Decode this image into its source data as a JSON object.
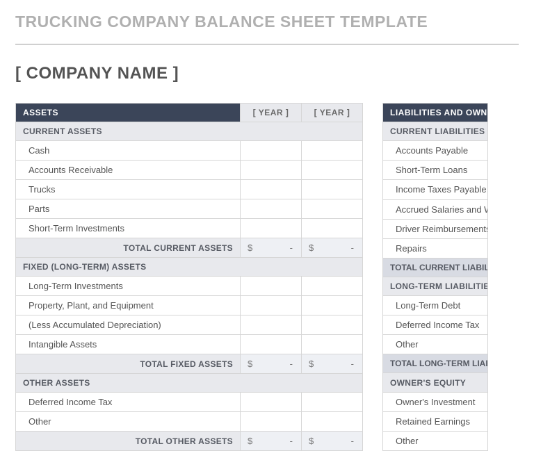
{
  "title": "TRUCKING COMPANY BALANCE SHEET TEMPLATE",
  "company": "[ COMPANY NAME ]",
  "year_label": "[ YEAR ]",
  "currency": "$",
  "dash": "-",
  "assets": {
    "header": "ASSETS",
    "current": {
      "label": "CURRENT ASSETS",
      "items": [
        "Cash",
        "Accounts Receivable",
        "Trucks",
        "Parts",
        "Short-Term Investments"
      ],
      "total_label": "TOTAL CURRENT ASSETS"
    },
    "fixed": {
      "label": "FIXED (LONG-TERM) ASSETS",
      "items": [
        "Long-Term Investments",
        "Property, Plant, and Equipment",
        "(Less Accumulated Depreciation)",
        "Intangible Assets"
      ],
      "total_label": "TOTAL FIXED ASSETS"
    },
    "other": {
      "label": "OTHER ASSETS",
      "items": [
        "Deferred Income Tax",
        "Other"
      ],
      "total_label": "TOTAL OTHER ASSETS"
    }
  },
  "liabilities": {
    "header": "LIABILITIES AND OWNER'S EQUITY",
    "current": {
      "label": "CURRENT LIABILITIES",
      "items": [
        "Accounts Payable",
        "Short-Term Loans",
        "Income Taxes Payable",
        "Accrued Salaries and Wages",
        "Driver Reimbursements",
        "Repairs"
      ],
      "total_label": "TOTAL CURRENT LIABILITIES"
    },
    "longterm": {
      "label": "LONG-TERM LIABILITIES",
      "items": [
        "Long-Term Debt",
        "Deferred Income Tax",
        "Other"
      ],
      "total_label": "TOTAL LONG-TERM LIABILITIES"
    },
    "equity": {
      "label": "OWNER'S EQUITY",
      "items": [
        "Owner's Investment",
        "Retained Earnings",
        "Other"
      ]
    }
  }
}
